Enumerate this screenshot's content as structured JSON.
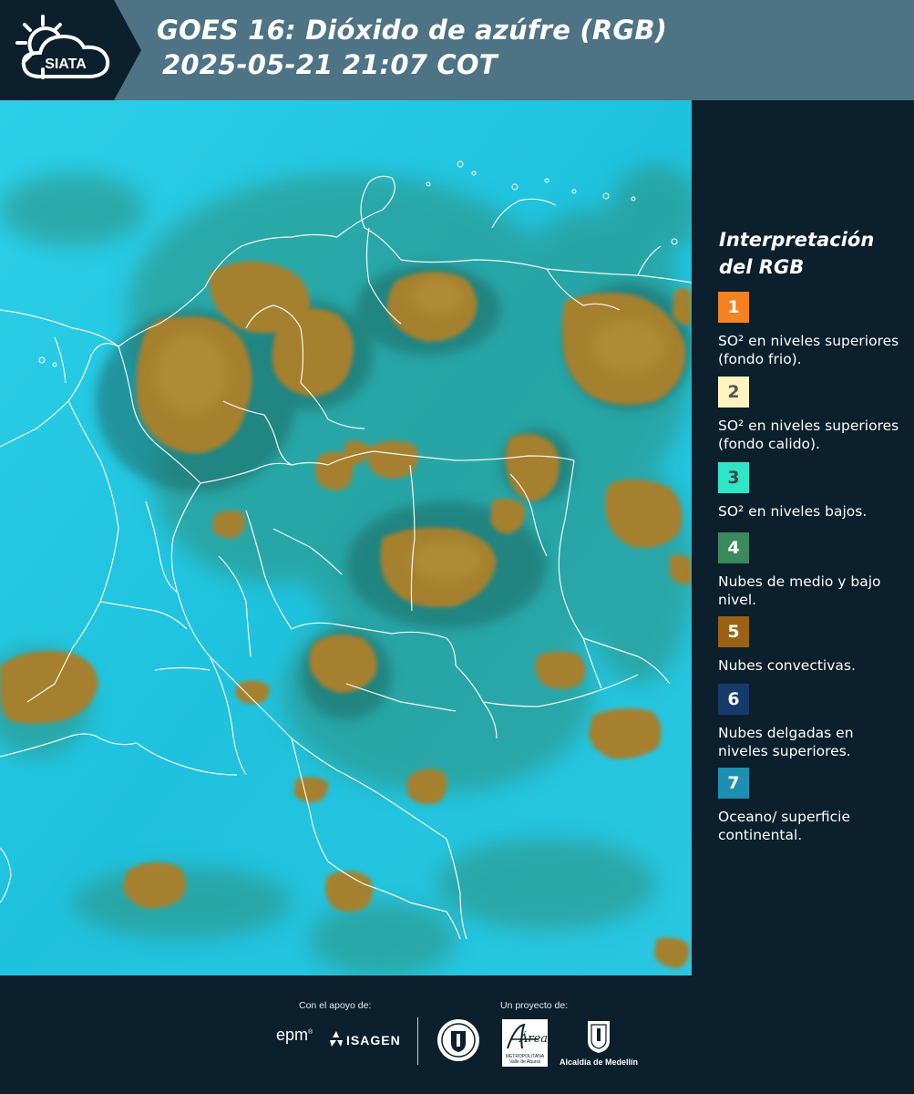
{
  "header": {
    "logo_text": "SIATA",
    "title_line1": "GOES 16: Dióxido de azúfre (RGB)",
    "title_line2": "2025-05-21 21:07 COT"
  },
  "legend": {
    "title_line1": "Interpretación",
    "title_line2": "del RGB",
    "items": [
      {
        "number": "1",
        "color": "#f58220",
        "num_color": "#ffffff",
        "text": "SO² en niveles superiores (fondo frio)."
      },
      {
        "number": "2",
        "color": "#fff3c0",
        "num_color": "#555555",
        "text": "SO² en niveles superiores (fondo calido)."
      },
      {
        "number": "3",
        "color": "#2ee6c6",
        "num_color": "#444444",
        "text": "SO² en niveles bajos."
      },
      {
        "number": "4",
        "color": "#3a8a5e",
        "num_color": "#ffffff",
        "text": "Nubes de medio y bajo nivel."
      },
      {
        "number": "5",
        "color": "#9a6212",
        "num_color": "#ffffff",
        "text": "Nubes convectivas."
      },
      {
        "number": "6",
        "color": "#163a6b",
        "num_color": "#ffffff",
        "text": "Nubes delgadas en niveles superiores."
      },
      {
        "number": "7",
        "color": "#1e8fb0",
        "num_color": "#ffffff",
        "text": "Oceano/ superficie continental."
      }
    ]
  },
  "footer": {
    "support_label": "Con el apoyo de:",
    "project_label": "Un proyecto de:",
    "sponsor1": "epm",
    "sponsor2": "ISAGEN",
    "area_name": "Área",
    "area_caption": "METROPOLITANA Valle de Aburrá",
    "alcaldia": "Alcaldía de Medellín"
  }
}
